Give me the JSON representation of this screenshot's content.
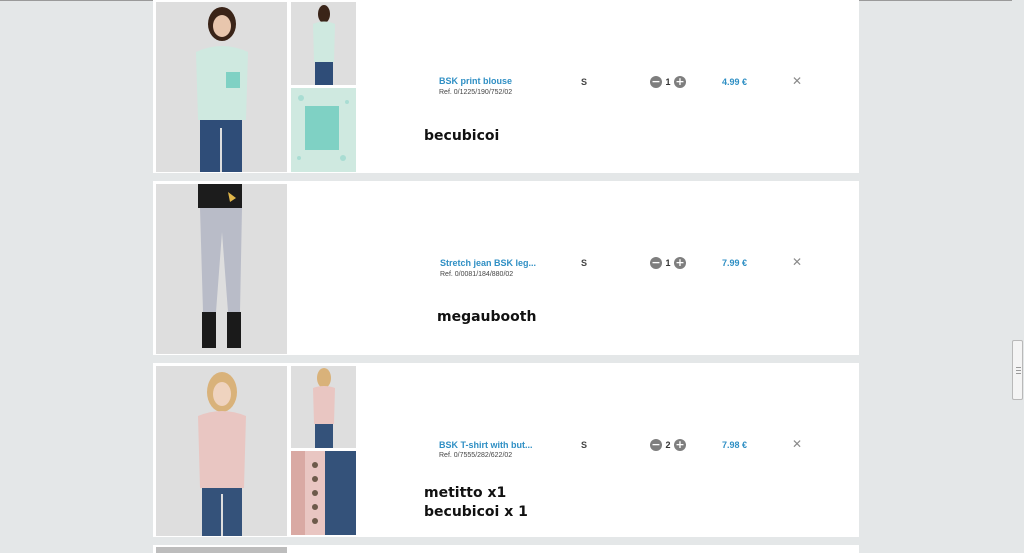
{
  "cart": {
    "items": [
      {
        "name": "BSK print blouse",
        "ref": "Ref. 0/1225/190/752/02",
        "size": "S",
        "quantity": "1",
        "price": "4.99 €",
        "note_lines": [
          "becubicoi"
        ],
        "colors": {
          "garment": "#cfe9e0",
          "accent": "#7fd1c4",
          "pants": "#2f4d78"
        }
      },
      {
        "name": "Stretch jean BSK leg...",
        "ref": "Ref. 0/0081/184/880/02",
        "size": "S",
        "quantity": "1",
        "price": "7.99 €",
        "note_lines": [
          "megaubooth"
        ],
        "colors": {
          "garment": "#1c1c1c",
          "accent": "#c8c8d0",
          "pants": "#b9bcc8"
        }
      },
      {
        "name": "BSK T-shirt with but...",
        "ref": "Ref. 0/7555/282/622/02",
        "size": "S",
        "quantity": "2",
        "price": "7.98 €",
        "note_lines": [
          "metitto x1",
          "becubicoi x 1"
        ],
        "colors": {
          "garment": "#e9c6c2",
          "accent": "#d9a9a3",
          "pants": "#34527a"
        }
      }
    ],
    "controls": {
      "minus": "−",
      "plus": "+",
      "remove": "✕"
    }
  },
  "colors": {
    "link": "#2f8fc4",
    "page_bg": "#e4e7e8",
    "card_bg": "#ffffff"
  }
}
